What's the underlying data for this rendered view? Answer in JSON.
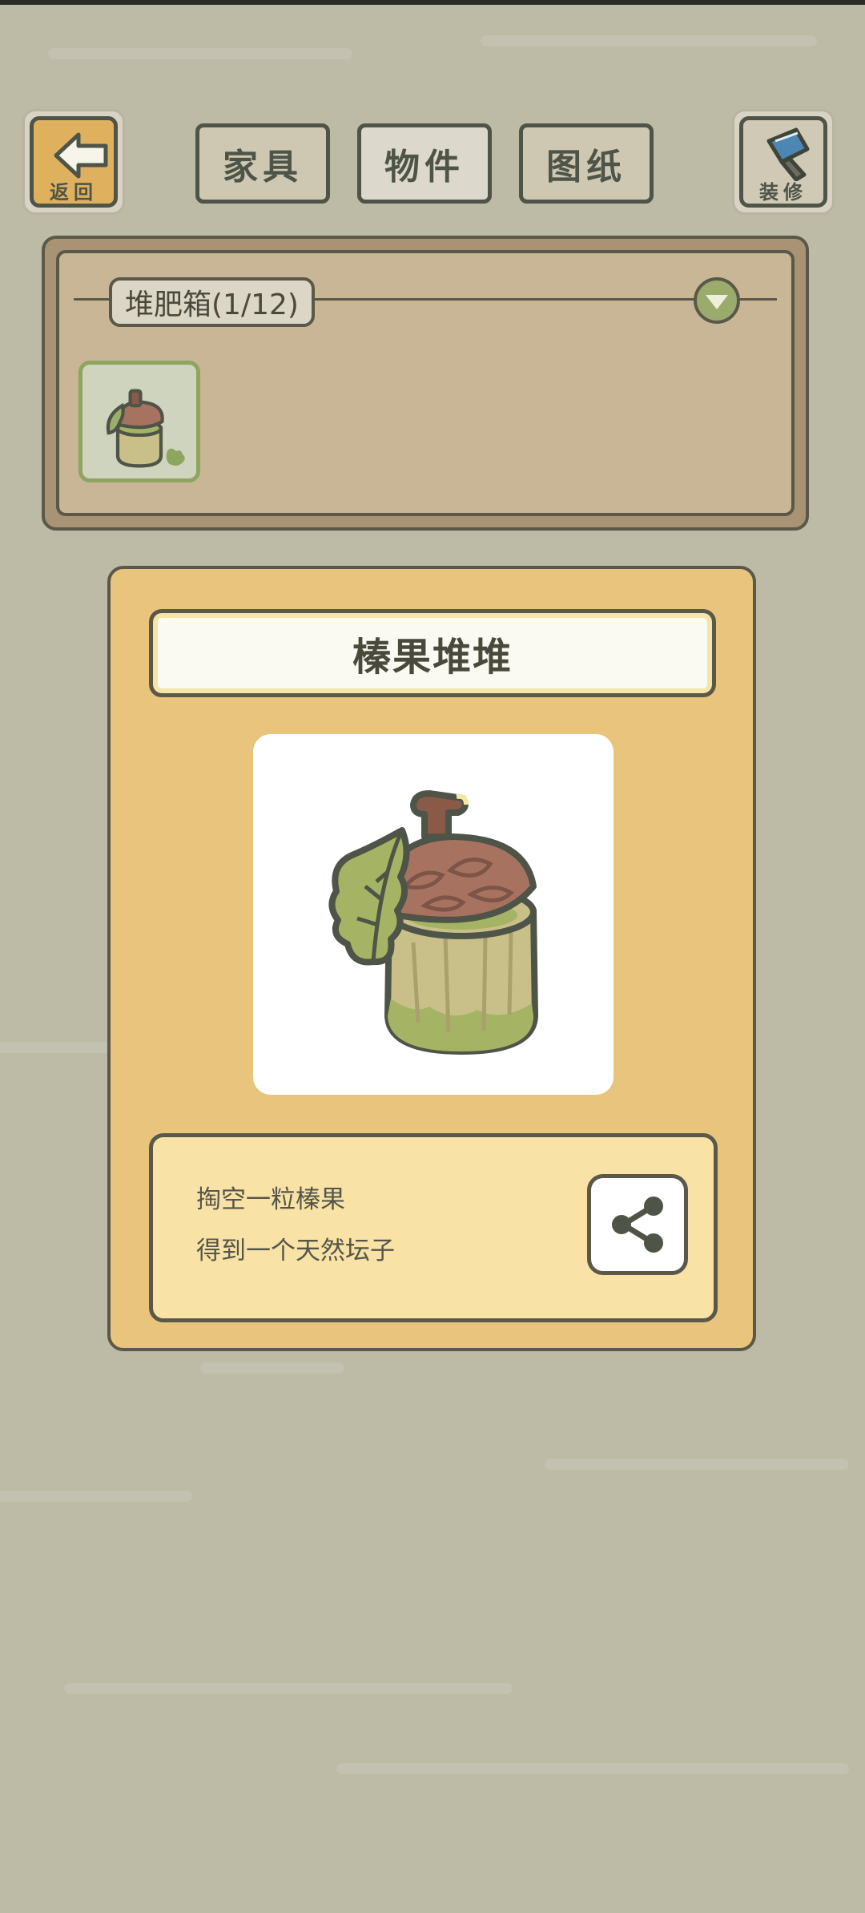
{
  "header": {
    "back_label": "返回",
    "decorate_label": "装修",
    "tabs": [
      {
        "label": "家具",
        "active": false
      },
      {
        "label": "物件",
        "active": true
      },
      {
        "label": "图纸",
        "active": false
      }
    ]
  },
  "category": {
    "label": "堆肥箱(1/12)",
    "items": [
      {
        "icon": "acorn-pot-icon",
        "selected": true
      }
    ]
  },
  "detail": {
    "name": "榛果堆堆",
    "description_lines": [
      "掏空一粒榛果",
      "得到一个天然坛子"
    ]
  },
  "colors": {
    "background": "#bdbaa6",
    "card": "#e8c47c",
    "outline": "#4e5447",
    "selection_green": "#8ea560"
  }
}
